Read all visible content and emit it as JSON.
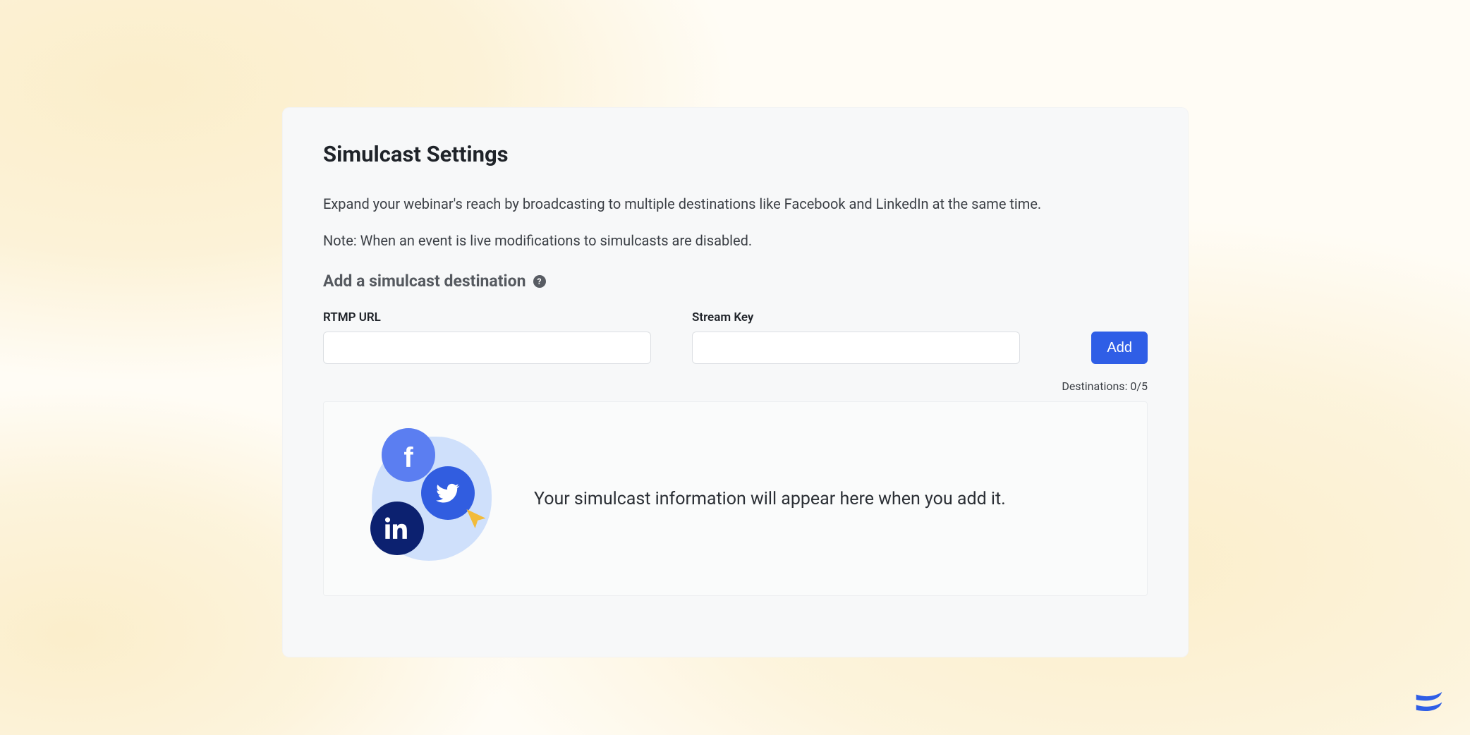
{
  "card": {
    "title": "Simulcast Settings",
    "description": "Expand your webinar's reach by broadcasting to multiple destinations like Facebook and LinkedIn at the same time.",
    "note": "Note: When an event is live modifications to simulcasts are disabled.",
    "subheading": "Add a simulcast destination",
    "help_symbol": "?",
    "form": {
      "rtmp_label": "RTMP URL",
      "rtmp_value": "",
      "stream_key_label": "Stream Key",
      "stream_key_value": "",
      "add_label": "Add"
    },
    "destinations_text": "Destinations: 0/5",
    "empty_state_text": "Your simulcast information will appear here when you add it."
  },
  "icons": {
    "facebook": "facebook-icon",
    "twitter": "twitter-icon",
    "linkedin": "linkedin-icon",
    "cursor": "cursor-icon",
    "brand": "brand-icon"
  },
  "colors": {
    "accent": "#2f5ee6",
    "card_bg": "#f7f8f9",
    "page_wash": "#fbeecb"
  }
}
